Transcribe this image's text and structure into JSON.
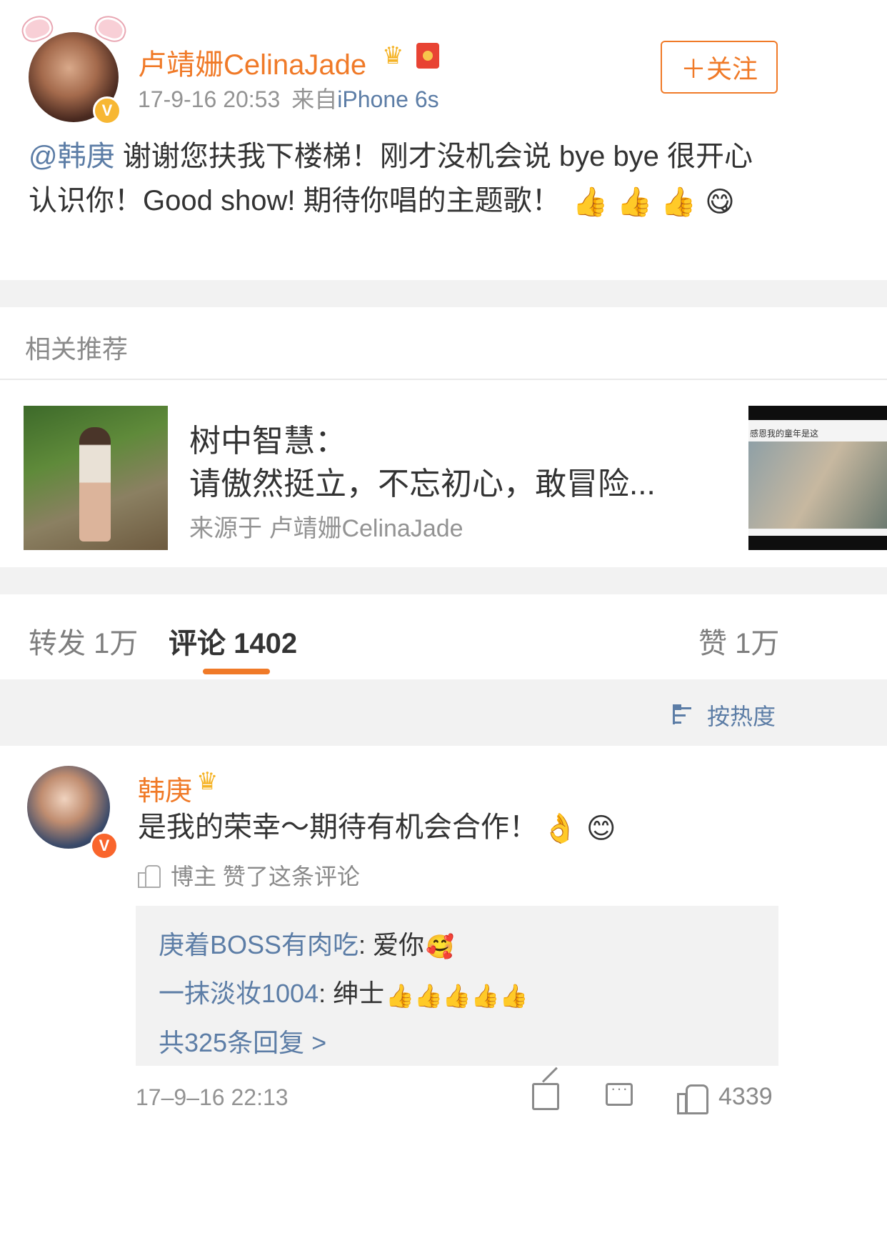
{
  "post": {
    "author": "卢靖姗CelinaJade",
    "time": "17-9-16 20:53",
    "source_prefix": "来自",
    "device": "iPhone 6s",
    "follow_label": "＋关注",
    "mention": "@韩庚",
    "text": " 谢谢您扶我下楼梯！刚才没机会说 bye bye 很开心认识你！Good show! 期待你唱的主题歌！",
    "emojis": [
      "👍",
      "👍",
      "👍",
      "😋"
    ]
  },
  "related": {
    "section_title": "相关推荐",
    "title_line1": "树中智慧：",
    "title_line2": "请傲然挺立，不忘初心，敢冒险...",
    "source": "来源于 卢靖姗CelinaJade",
    "peek_caption": "感恩我的童年是这"
  },
  "tabs": {
    "repost": "转发 1万",
    "comments": "评论 1402",
    "likes": "赞 1万"
  },
  "sort": {
    "label": "按热度"
  },
  "comment": {
    "author": "韩庚",
    "text": "是我的荣幸～期待有机会合作！",
    "emojis": [
      "👌",
      "😊"
    ],
    "liked_by_author": "博主 赞了这条评论",
    "replies": [
      {
        "name": "庚着BOSS有肉吃",
        "text": ": 爱你",
        "emoji": "🥰"
      },
      {
        "name": "一抹淡妆1004",
        "text": ": 绅士",
        "emoji": "👍👍👍👍👍"
      }
    ],
    "more_replies": "共325条回复 >",
    "time": "17–9–16 22:13",
    "like_count": "4339"
  }
}
